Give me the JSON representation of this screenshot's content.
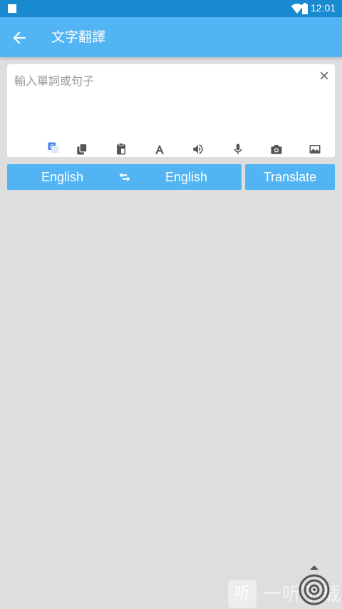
{
  "status_bar": {
    "time": "12:01"
  },
  "app_bar": {
    "title": "文字翻譯"
  },
  "input": {
    "placeholder": "輸入單詞或句子",
    "value": ""
  },
  "toolbar": {
    "icons": [
      "translate-icon",
      "copy-icon",
      "clipboard-icon",
      "font-icon",
      "speaker-icon",
      "mic-icon",
      "camera-icon",
      "image-icon"
    ]
  },
  "language_bar": {
    "source": "English",
    "target": "English"
  },
  "translate_button": {
    "label": "Translate"
  },
  "watermark": {
    "icon_char": "听",
    "text": "一听下载"
  },
  "colors": {
    "primary": "#52b4f2",
    "status_bar": "#1a8ad0",
    "background": "#dedede"
  }
}
